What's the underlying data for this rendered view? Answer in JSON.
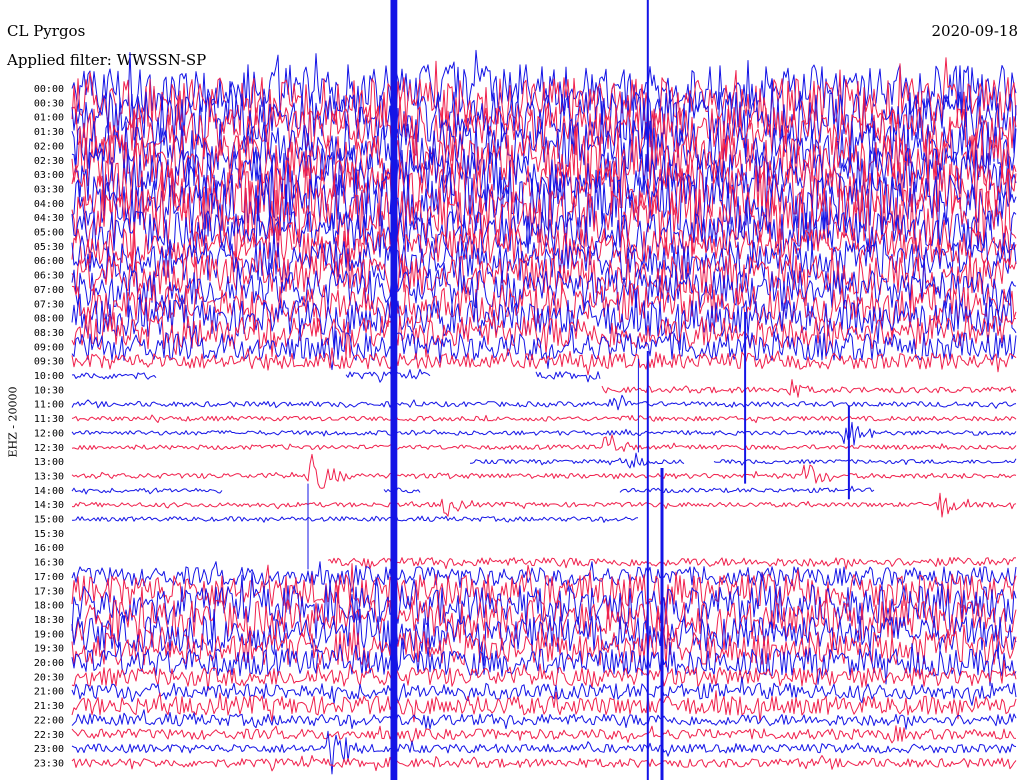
{
  "header": {
    "station": "CL Pyrgos",
    "filter": "Applied filter: WWSSN-SP",
    "date": "2020-09-18",
    "channel": "EHZ - 20000"
  },
  "colors": {
    "even": "#1414e6",
    "odd": "#f0204c",
    "background": "#ffffff"
  },
  "chart_data": {
    "type": "line",
    "kind": "helicorder",
    "title": "CL Pyrgos",
    "subtitle": "Applied filter: WWSSN-SP",
    "ylabel": "EHZ - 20000",
    "tick_labels": [
      "00:00",
      "00:30",
      "01:00",
      "01:30",
      "02:00",
      "02:30",
      "03:00",
      "03:30",
      "04:00",
      "04:30",
      "05:00",
      "05:30",
      "06:00",
      "06:30",
      "07:00",
      "07:30",
      "08:00",
      "08:30",
      "09:00",
      "09:30",
      "10:00",
      "10:30",
      "11:00",
      "11:30",
      "12:00",
      "12:30",
      "13:00",
      "13:30",
      "14:00",
      "14:30",
      "15:00",
      "15:30",
      "16:00",
      "16:30",
      "17:00",
      "17:30",
      "18:00",
      "18:30",
      "19:00",
      "19:30",
      "20:00",
      "20:30",
      "21:00",
      "21:30",
      "22:00",
      "22:30",
      "23:00",
      "23:30"
    ],
    "x_minutes_per_line": 30,
    "series_amplitude": [
      1.6,
      1.7,
      1.7,
      1.7,
      1.7,
      1.7,
      1.8,
      1.9,
      2.0,
      2.0,
      1.4,
      1.2,
      1.3,
      1.3,
      1.3,
      1.3,
      1.2,
      1.1,
      0.9,
      0.5,
      0.2,
      0.15,
      0.12,
      0.1,
      0.1,
      0.1,
      0.08,
      0.12,
      0.1,
      0.1,
      0.1,
      0.05,
      0.0,
      0.25,
      0.6,
      1.1,
      1.3,
      1.3,
      1.2,
      1.1,
      0.9,
      0.6,
      0.5,
      0.6,
      0.35,
      0.3,
      0.25,
      0.25
    ],
    "gaps": {
      "20": [
        [
          0.09,
          0.29
        ],
        [
          0.38,
          0.49
        ],
        [
          0.56,
          1.0
        ]
      ],
      "21": [
        [
          0.0,
          0.56
        ]
      ],
      "26": [
        [
          0.0,
          0.42
        ],
        [
          0.65,
          0.68
        ]
      ],
      "28": [
        [
          0.16,
          0.33
        ],
        [
          0.37,
          0.58
        ],
        [
          0.85,
          1.0
        ]
      ],
      "30": [
        [
          0.6,
          1.0
        ]
      ],
      "31": [
        [
          0.0,
          1.0
        ]
      ],
      "32": [
        [
          0.0,
          1.0
        ]
      ],
      "33": [
        [
          0.0,
          0.27
        ]
      ]
    },
    "events": [
      {
        "line": 27,
        "pos": 0.255,
        "amp": 25
      },
      {
        "line": 25,
        "pos": 0.565,
        "amp": 14
      },
      {
        "line": 29,
        "pos": 0.395,
        "amp": 14
      },
      {
        "line": 24,
        "pos": 0.82,
        "amp": 20
      },
      {
        "line": 27,
        "pos": 0.775,
        "amp": 18
      },
      {
        "line": 29,
        "pos": 0.92,
        "amp": 16
      },
      {
        "line": 26,
        "pos": 0.585,
        "amp": 12
      },
      {
        "line": 20,
        "pos": 0.915,
        "amp": 16
      },
      {
        "line": 21,
        "pos": 0.76,
        "amp": 12
      },
      {
        "line": 22,
        "pos": 0.575,
        "amp": 14
      },
      {
        "line": 46,
        "pos": 0.275,
        "amp": 28
      },
      {
        "line": 45,
        "pos": 0.87,
        "amp": 12
      },
      {
        "line": 39,
        "pos": 0.62,
        "amp": 60
      }
    ],
    "spikes": [
      {
        "x": 0.34,
        "from": 0.0,
        "to": 1.0,
        "width": 5
      },
      {
        "x": 0.343,
        "from": 0.0,
        "to": 1.0,
        "width": 3
      },
      {
        "x": 0.61,
        "from": 0.0,
        "to": 0.22,
        "width": 2
      },
      {
        "x": 0.61,
        "from": 0.45,
        "to": 1.0,
        "width": 2
      },
      {
        "x": 0.625,
        "from": 0.6,
        "to": 1.0,
        "width": 3
      },
      {
        "x": 0.713,
        "from": 0.4,
        "to": 0.62,
        "width": 2
      },
      {
        "x": 0.823,
        "from": 0.52,
        "to": 0.64,
        "width": 2
      },
      {
        "x": 0.25,
        "from": 0.62,
        "to": 0.73,
        "width": 1
      },
      {
        "x": 0.6,
        "from": 0.46,
        "to": 0.58,
        "width": 1
      }
    ]
  }
}
